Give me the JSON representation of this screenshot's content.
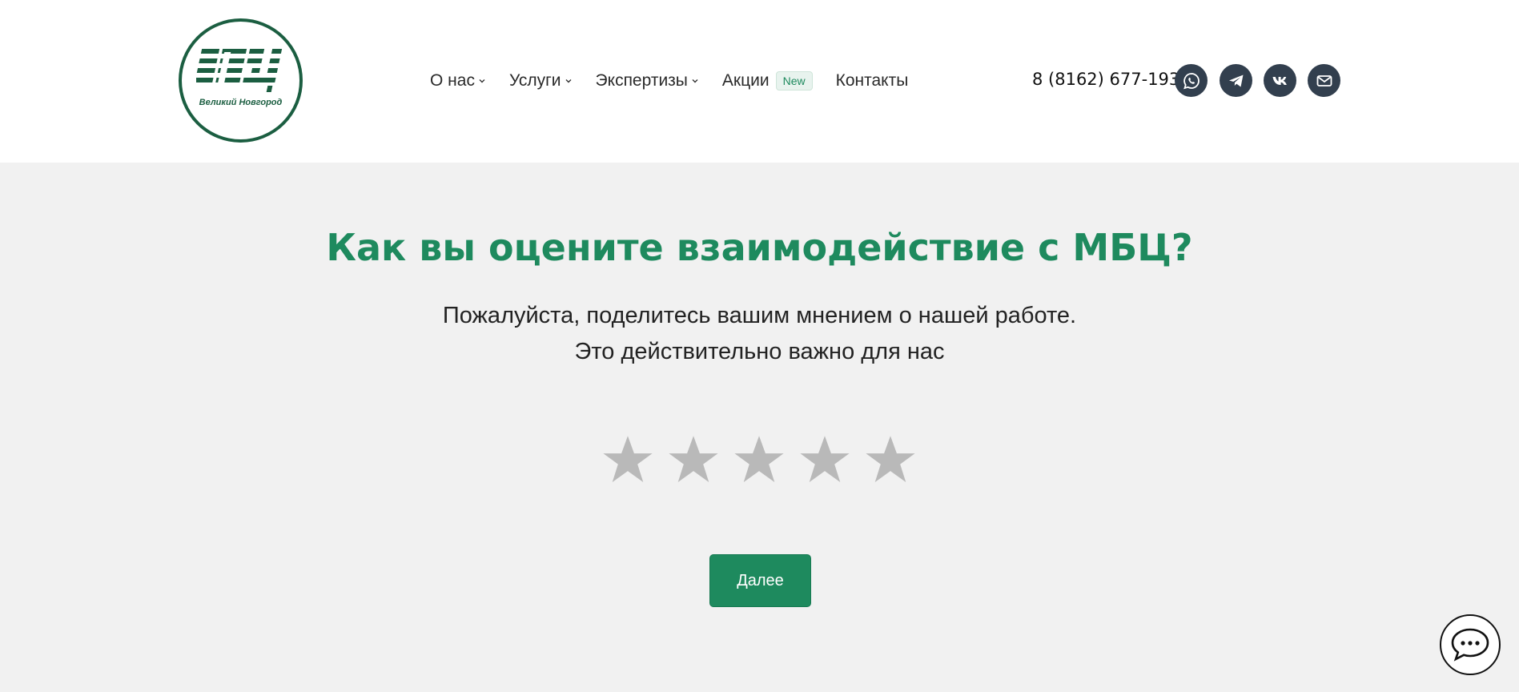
{
  "logo": {
    "mark": "МБЦ",
    "subtitle": "Великий Новгород"
  },
  "nav": {
    "items": [
      {
        "label": "О нас",
        "dropdown": true
      },
      {
        "label": "Услуги",
        "dropdown": true
      },
      {
        "label": "Экспертизы",
        "dropdown": true
      },
      {
        "label": "Акции",
        "dropdown": false,
        "badge": "New"
      },
      {
        "label": "Контакты",
        "dropdown": false
      }
    ]
  },
  "contacts": {
    "phone": "8 (8162) 677-193",
    "social": [
      "whatsapp-icon",
      "telegram-icon",
      "vk-icon",
      "mail-icon"
    ]
  },
  "survey": {
    "title": "Как вы оцените взаимодействие с МБЦ?",
    "subtitle_line1": "Пожалуйста, поделитесь вашим мнением о нашей работе.",
    "subtitle_line2": "Это действительно важно для нас",
    "rating": 0,
    "max_rating": 5,
    "next_label": "Далее"
  },
  "colors": {
    "brand_green": "#1e8a5e",
    "logo_green": "#1b5e41",
    "social_bg": "#323f4e",
    "star_inactive": "#b9b9b9",
    "page_bg": "#f1f1f1"
  }
}
